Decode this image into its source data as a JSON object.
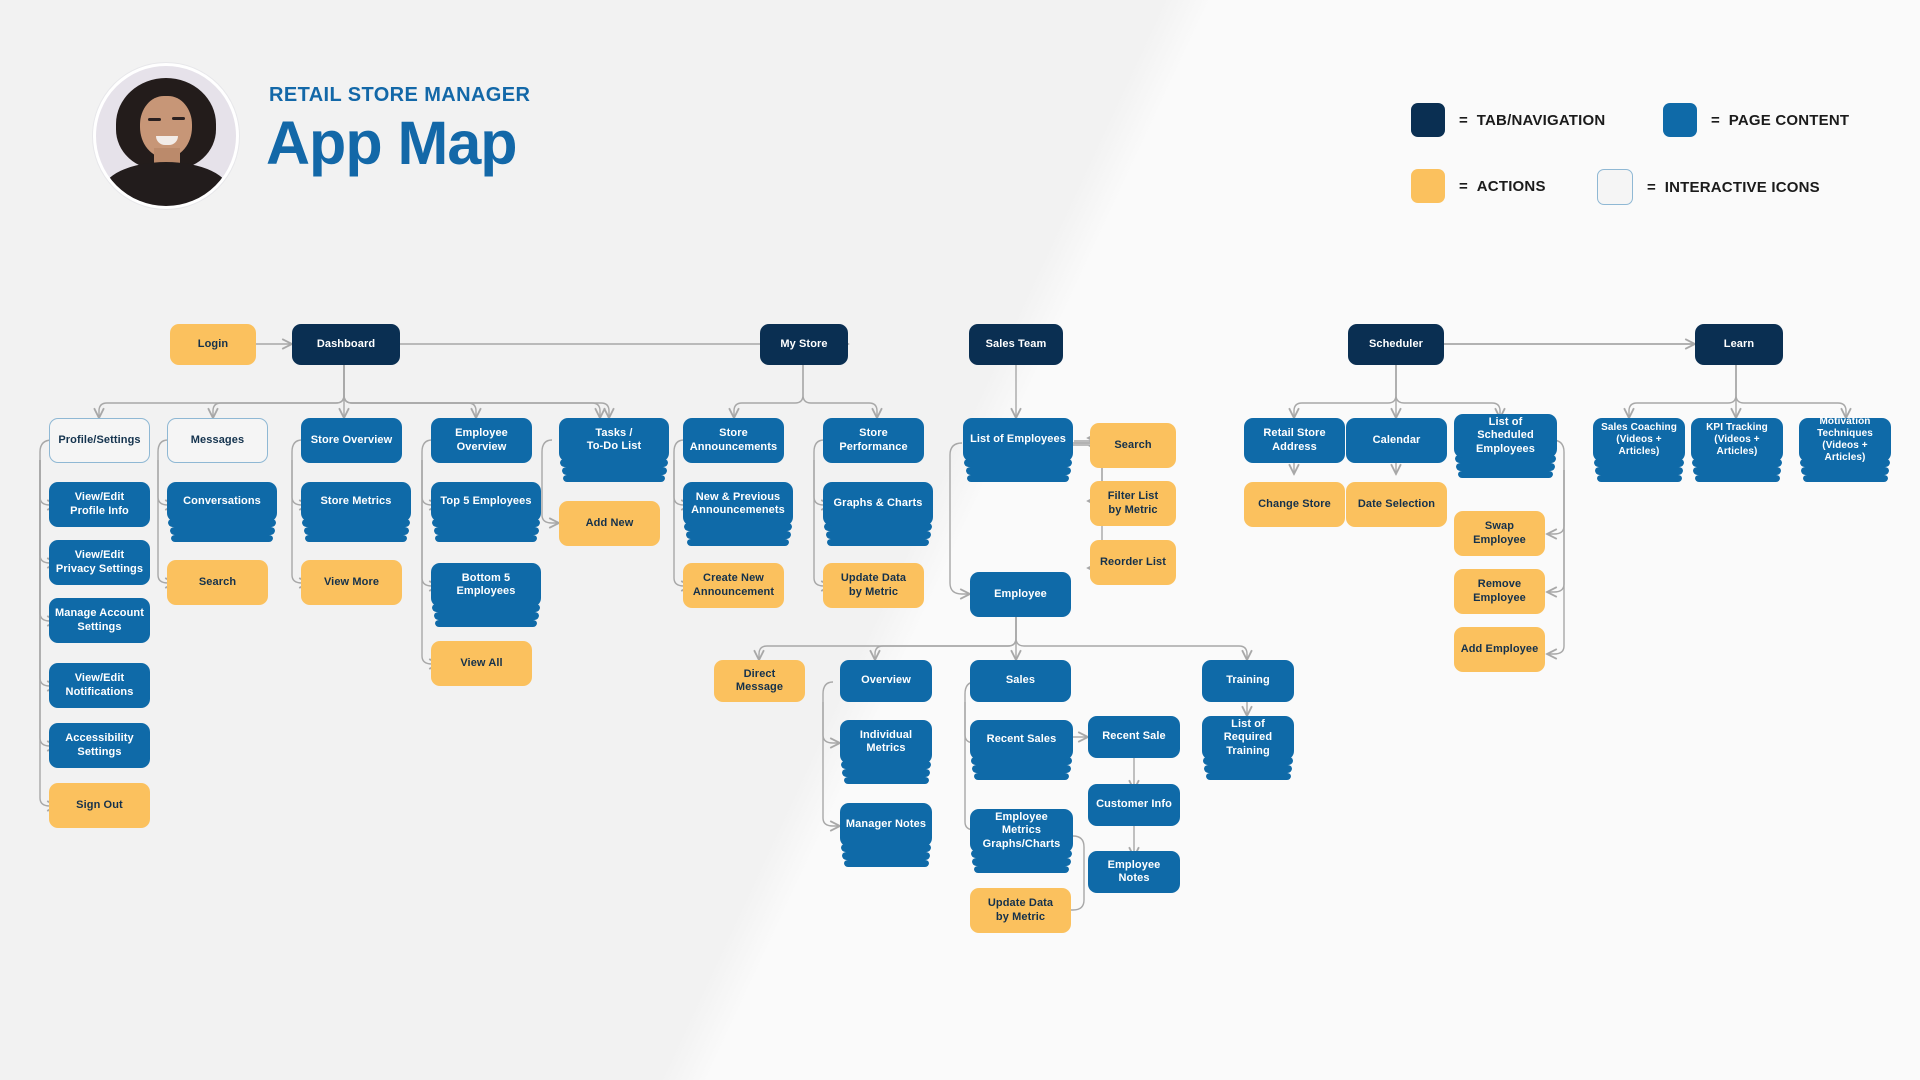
{
  "header": {
    "kicker": "RETAIL STORE MANAGER",
    "title": "App Map",
    "avatar_alt": "woman-portrait"
  },
  "colors": {
    "nav": "#0a2f52",
    "page": "#0f6aa8",
    "action": "#fbc15e",
    "icon_border": "#8fb8d4",
    "accent_text": "#1368a8",
    "background": "#f4f4f4",
    "connector": "#a8a8a8"
  },
  "legend": {
    "equals": "=",
    "items": [
      {
        "label": "TAB/NAVIGATION",
        "swatch": "nav"
      },
      {
        "label": "PAGE CONTENT",
        "swatch": "page"
      },
      {
        "label": "ACTIONS",
        "swatch": "action"
      },
      {
        "label": "INTERACTIVE ICONS",
        "swatch": "icon"
      }
    ]
  },
  "nodes": {
    "login": "Login",
    "dashboard": "Dashboard",
    "my_store": "My Store",
    "sales_team": "Sales Team",
    "scheduler": "Scheduler",
    "learn": "Learn",
    "profile_settings": "Profile/Settings",
    "view_edit_profile_info": "View/Edit\nProfile Info",
    "view_edit_privacy_settings": "View/Edit\nPrivacy Settings",
    "manage_account_settings": "Manage Account\nSettings",
    "view_edit_notifications": "View/Edit\nNotifications",
    "accessibility_settings": "Accessibility\nSettings",
    "sign_out": "Sign Out",
    "messages": "Messages",
    "conversations": "Conversations",
    "search_messages": "Search",
    "store_overview": "Store Overview",
    "store_metrics": "Store Metrics",
    "view_more": "View More",
    "employee_overview": "Employee\nOverview",
    "top_5_employees": "Top 5 Employees",
    "bottom_5_employees": "Bottom 5\nEmployees",
    "view_all": "View All",
    "tasks_todo_list": "Tasks /\nTo-Do List",
    "add_new": "Add New",
    "store_announcements": "Store\nAnnouncements",
    "new_previous_announcements": "New & Previous\nAnnouncemenets",
    "create_new_announcement": "Create New\nAnnouncement",
    "store_performance": "Store\nPerformance",
    "graphs_charts": "Graphs & Charts",
    "update_data_by_metric_store": "Update Data\nby Metric",
    "list_of_employees": "List of Employees",
    "search_employees": "Search",
    "filter_list_by_metric": "Filter List\nby Metric",
    "reorder_list": "Reorder List",
    "employee": "Employee",
    "direct_message": "Direct Message",
    "overview": "Overview",
    "individual_metrics": "Individual\nMetrics",
    "manager_notes": "Manager Notes",
    "sales": "Sales",
    "recent_sales": "Recent Sales",
    "employee_metrics_graphs_charts": "Employee Metrics\nGraphs/Charts",
    "update_data_by_metric_employee": "Update Data\nby Metric",
    "recent_sale": "Recent Sale",
    "customer_info": "Customer Info",
    "employee_notes": "Employee Notes",
    "training": "Training",
    "list_of_required_training": "List of Required\nTraining",
    "retail_store_address": "Retail Store\nAddress",
    "change_store": "Change Store",
    "calendar": "Calendar",
    "date_selection": "Date Selection",
    "list_of_scheduled_employees": "List of Scheduled\nEmployees",
    "swap_employee": "Swap Employee",
    "remove_employee": "Remove\nEmployee",
    "add_employee": "Add Employee",
    "sales_coaching": "Sales Coaching\n(Videos + Articles)",
    "kpi_tracking": "KPI Tracking\n(Videos + Articles)",
    "motivation_techniques": "Motivation\nTechniques\n(Videos + Articles)"
  }
}
